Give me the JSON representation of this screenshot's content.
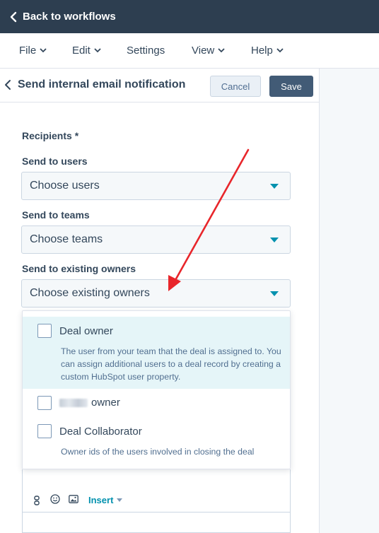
{
  "topbar": {
    "back_label": "Back to workflows"
  },
  "menu": [
    {
      "label": "File"
    },
    {
      "label": "Edit"
    },
    {
      "label": "Settings"
    },
    {
      "label": "View"
    },
    {
      "label": "Help"
    }
  ],
  "panel": {
    "title": "Send internal email notification",
    "cancel_label": "Cancel",
    "save_label": "Save"
  },
  "form": {
    "recipients_label": "Recipients *",
    "users_label": "Send to users",
    "users_placeholder": "Choose users",
    "teams_label": "Send to teams",
    "teams_placeholder": "Choose teams",
    "owners_label": "Send to existing owners",
    "owners_placeholder": "Choose existing owners"
  },
  "dropdown": {
    "options": [
      {
        "label": "Deal owner",
        "description": "The user from your team that the deal is assigned to. You can assign additional users to a deal record by creating a custom HubSpot user property."
      },
      {
        "label": "owner",
        "description": ""
      },
      {
        "label": "Deal Collaborator",
        "description": "Owner ids of the users involved in closing the deal"
      }
    ]
  },
  "editor": {
    "insert_label": "Insert"
  },
  "colors": {
    "topbar": "#2d3e50",
    "accent": "#0091ae",
    "save": "#425b76",
    "annotation_arrow": "#e8262b"
  }
}
